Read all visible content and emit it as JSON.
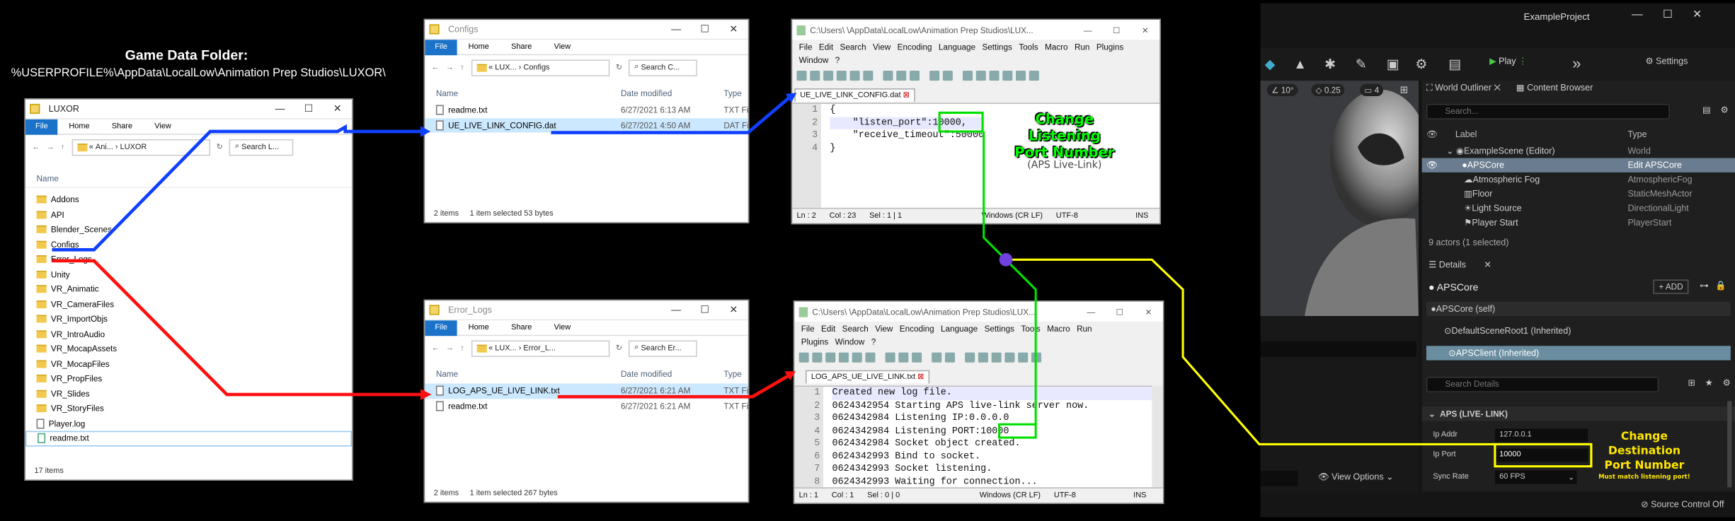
{
  "game_data": {
    "title": "Game Data Folder:",
    "path": "%USERPROFILE%\\AppData\\LocalLow\\Animation Prep Studios\\LUXOR\\"
  },
  "explorer_main": {
    "title": "LUXOR",
    "ribbon": [
      "File",
      "Home",
      "Share",
      "View"
    ],
    "address": [
      "«",
      "Ani...",
      "›",
      "LUXOR"
    ],
    "search_placeholder": "Search L...",
    "column_name": "Name",
    "items": [
      "Addons",
      "API",
      "Blender_Scenes",
      "Configs",
      "Error_Logs",
      "Unity",
      "VR_Animatic",
      "VR_CameraFiles",
      "VR_ImportObjs",
      "VR_IntroAudio",
      "VR_MocapAssets",
      "VR_MocapFiles",
      "VR_PropFiles",
      "VR_Slides",
      "VR_StoryFiles",
      "Player.log",
      "readme.txt"
    ],
    "status": "17 items"
  },
  "explorer_configs": {
    "title": "Configs",
    "ribbon": [
      "File",
      "Home",
      "Share",
      "View"
    ],
    "address": [
      "«",
      "LUX...",
      "›",
      "Configs"
    ],
    "search_placeholder": "Search C...",
    "columns": [
      "Name",
      "Date modified",
      "Type"
    ],
    "rows": [
      {
        "name": "readme.txt",
        "date": "6/27/2021 6:13 AM",
        "type": "TXT File"
      },
      {
        "name": "UE_LIVE_LINK_CONFIG.dat",
        "date": "6/27/2021 4:50 AM",
        "type": "DAT File"
      }
    ],
    "status": [
      "2 items",
      "1 item selected  53 bytes"
    ]
  },
  "explorer_errors": {
    "title": "Error_Logs",
    "ribbon": [
      "File",
      "Home",
      "Share",
      "View"
    ],
    "address": [
      "«",
      "LUX...",
      "›",
      "Error_L..."
    ],
    "search_placeholder": "Search Er...",
    "columns": [
      "Name",
      "Date modified",
      "Type"
    ],
    "rows": [
      {
        "name": "LOG_APS_UE_LIVE_LINK.txt",
        "date": "6/27/2021 6:21 AM",
        "type": "TXT File"
      },
      {
        "name": "readme.txt",
        "date": "6/27/2021 6:21 AM",
        "type": "TXT File"
      }
    ],
    "status": [
      "2 items",
      "1 item selected  267 bytes"
    ]
  },
  "npp_config": {
    "title": "C:\\Users\\        \\AppData\\LocalLow\\Animation Prep Studios\\LUX...",
    "menu": [
      "File",
      "Edit",
      "Search",
      "View",
      "Encoding",
      "Language",
      "Settings",
      "Tools",
      "Macro",
      "Run",
      "Plugins"
    ],
    "menu2": [
      "Window",
      "?"
    ],
    "tab": "UE_LIVE_LINK_CONFIG.dat",
    "lines": [
      "{",
      "    \"listen_port\":10000,",
      "    \"receive_timeout\":50000",
      "}"
    ],
    "status": [
      "Ln : 2",
      "Col : 23",
      "Sel : 1 | 1",
      "Windows (CR LF)",
      "UTF-8",
      "INS"
    ]
  },
  "npp_log": {
    "title": "C:\\Users\\        \\AppData\\LocalLow\\Animation Prep Studios\\LUX...",
    "menu": [
      "File",
      "Edit",
      "Search",
      "View",
      "Encoding",
      "Language",
      "Settings",
      "Tools",
      "Macro",
      "Run"
    ],
    "menu2": [
      "Plugins",
      "Window",
      "?"
    ],
    "tab": "LOG_APS_UE_LIVE_LINK.txt",
    "lines": [
      "Created new log file.",
      "0624342954 Starting APS live-link server now.",
      "0624342984 Listening IP:0.0.0.0",
      "0624342984 Listening PORT:10000",
      "0624342984 Socket object created.",
      "0624342993 Bind to socket.",
      "0624342993 Socket listening.",
      "0624342993 Waiting for connection..."
    ],
    "status": [
      "Ln : 1",
      "Col : 1",
      "Sel : 0 | 0",
      "Windows (CR LF)",
      "UTF-8",
      "INS"
    ]
  },
  "callouts": {
    "listen_1": "Change Listening",
    "listen_2": "Port Number",
    "listen_3": "(APS Live-Link)",
    "dest_1": "Change",
    "dest_2": "Destination",
    "dest_3": "Port Number",
    "dest_4": "Must match listening port!"
  },
  "ue": {
    "project": "ExampleProject",
    "play": "Play",
    "settings": "Settings",
    "viewport_chips": [
      "10°",
      "0.25",
      "4"
    ],
    "view_options": "View Options",
    "outliner_tab": "World Outliner",
    "content_tab": "Content Browser",
    "search": "Search...",
    "col_label": "Label",
    "col_type": "Type",
    "tree": [
      {
        "label": "ExampleScene (Editor)",
        "type": "World"
      },
      {
        "label": "APSCore",
        "type": "Edit APSCore"
      },
      {
        "label": "Atmospheric Fog",
        "type": "AtmosphericFog"
      },
      {
        "label": "Floor",
        "type": "StaticMeshActor"
      },
      {
        "label": "Light Source",
        "type": "DirectionalLight"
      },
      {
        "label": "Player Start",
        "type": "PlayerStart"
      }
    ],
    "actors": "9 actors (1 selected)",
    "details_tab": "Details",
    "actor_name": "APSCore",
    "add": "+ ADD",
    "components": [
      "APSCore (self)",
      "DefaultSceneRoot1 (Inherited)",
      "APSClient (Inherited)"
    ],
    "search_details": "Search Details",
    "section": "APS (LIVE- LINK)",
    "props": [
      {
        "label": "Ip Addr",
        "value": "127.0.0.1"
      },
      {
        "label": "Ip Port",
        "value": "10000"
      },
      {
        "label": "Sync Rate",
        "value": "60 FPS"
      }
    ],
    "source_control": "Source Control Off"
  },
  "colors": {
    "blue_line": "#1040ff",
    "red_line": "#ff1010",
    "green_line": "#00e000",
    "yellow_line": "#ffff00",
    "node": "#7040e0",
    "explorer_accent": "#1a73c8"
  }
}
